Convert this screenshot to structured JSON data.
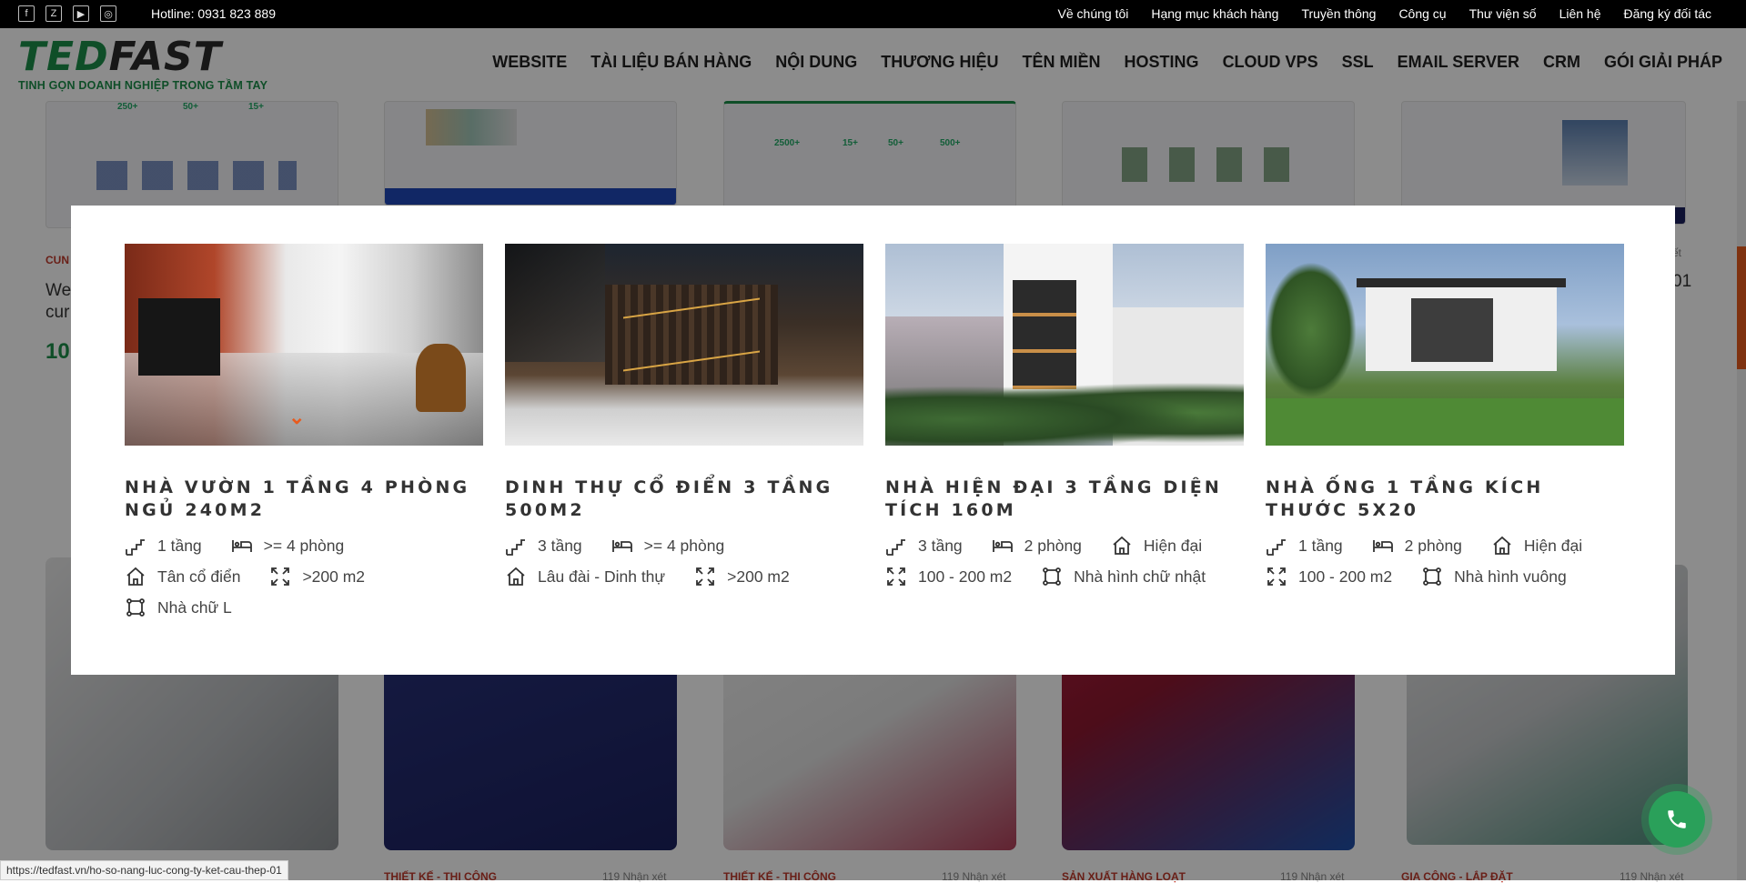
{
  "topbar": {
    "hotline": "Hotline: 0931 823 889",
    "links": [
      "Về chúng tôi",
      "Hạng mục khách hàng",
      "Truyền thông",
      "Công cụ",
      "Thư viện số",
      "Liên hệ",
      "Đăng ký đối tác"
    ]
  },
  "logo": {
    "brand_a": "TED",
    "brand_b": "FAST",
    "tagline": "TINH GỌN DOANH NGHIỆP TRONG TẦM TAY"
  },
  "nav": [
    "WEBSITE",
    "TÀI LIỆU BÁN HÀNG",
    "NỘI DUNG",
    "THƯƠNG HIỆU",
    "TÊN MIỀN",
    "HOSTING",
    "CLOUD VPS",
    "SSL",
    "EMAIL SERVER",
    "CRM",
    "GÓI GIẢI PHÁP"
  ],
  "background": {
    "left_label": "CUN",
    "left_text_1": "We",
    "left_text_2": "cur",
    "left_price": "10.",
    "right_snip_1": "ết",
    "right_snip_2": "01",
    "thumb_stats": [
      "250+",
      "50+",
      "15+",
      "2500+",
      "15+",
      "50+",
      "500+"
    ],
    "brochure_labels": [
      {
        "cat": "THIẾT KẾ - THI CÔNG",
        "count": "119 Nhận xét"
      },
      {
        "cat": "THIẾT KẾ - THI CÔNG",
        "count": "119 Nhận xét"
      },
      {
        "cat": "SẢN XUẤT HÀNG LOẠT",
        "count": "119 Nhận xét"
      },
      {
        "cat": "GIA CÔNG - LẮP ĐẶT",
        "count": "119 Nhận xét"
      }
    ]
  },
  "modal": {
    "cards": [
      {
        "title": "NHÀ VƯỜN 1 TẦNG 4 PHÒNG NGỦ 240M2",
        "features": [
          {
            "icon": "stairs-icon",
            "text": "1 tầng"
          },
          {
            "icon": "bed-icon",
            "text": ">= 4 phòng"
          },
          {
            "icon": "house-icon",
            "text": "Tân cổ điển"
          },
          {
            "icon": "area-icon",
            "text": ">200 m2"
          },
          {
            "icon": "shape-icon",
            "text": "Nhà chữ L"
          }
        ]
      },
      {
        "title": "DINH THỰ CỔ ĐIỂN 3 TẦNG 500M2",
        "features": [
          {
            "icon": "stairs-icon",
            "text": "3 tầng"
          },
          {
            "icon": "bed-icon",
            "text": ">= 4 phòng"
          },
          {
            "icon": "house-icon",
            "text": "Lâu đài - Dinh thự"
          },
          {
            "icon": "area-icon",
            "text": ">200 m2"
          }
        ]
      },
      {
        "title": "NHÀ HIỆN ĐẠI 3 TẦNG DIỆN TÍCH 160M",
        "features": [
          {
            "icon": "stairs-icon",
            "text": "3 tầng"
          },
          {
            "icon": "bed-icon",
            "text": "2 phòng"
          },
          {
            "icon": "house-icon",
            "text": "Hiện đại"
          },
          {
            "icon": "area-icon",
            "text": "100 - 200 m2"
          },
          {
            "icon": "shape-icon",
            "text": "Nhà hình chữ nhật"
          }
        ]
      },
      {
        "title": "NHÀ ỐNG 1 TẦNG KÍCH THƯỚC 5X20",
        "features": [
          {
            "icon": "stairs-icon",
            "text": "1 tầng"
          },
          {
            "icon": "bed-icon",
            "text": "2 phòng"
          },
          {
            "icon": "house-icon",
            "text": "Hiện đại"
          },
          {
            "icon": "area-icon",
            "text": "100 - 200 m2"
          },
          {
            "icon": "shape-icon",
            "text": "Nhà hình vuông"
          }
        ]
      }
    ]
  },
  "status_url": "https://tedfast.vn/ho-so-nang-luc-cong-ty-ket-cau-thep-01",
  "colors": {
    "brand_green": "#1c8f4a",
    "accent_orange": "#e85b1e",
    "call_green": "#2aa05a"
  }
}
